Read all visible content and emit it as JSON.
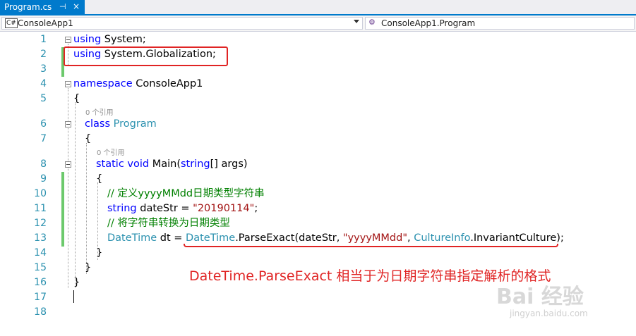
{
  "tab": {
    "title": "Program.cs",
    "pin": "⊣",
    "close": "×"
  },
  "navbar": {
    "project": {
      "icon": "C#",
      "label": "ConsoleApp1"
    },
    "member": {
      "icon": "⚙",
      "label": "ConsoleApp1.Program"
    }
  },
  "line_numbers": [
    "1",
    "2",
    "3",
    "4",
    "5",
    "6",
    "7",
    "8",
    "9",
    "10",
    "11",
    "12",
    "13",
    "14",
    "15",
    "16",
    "17",
    "18"
  ],
  "code": {
    "l1_kw": "using",
    "l1_rest": " System;",
    "l2_kw": "using",
    "l2_rest": " System.Globalization;",
    "l4_kw": "namespace",
    "l4_rest": " ConsoleApp1",
    "l5": "{",
    "ref_class": "0 个引用",
    "l6_kw": "class",
    "l6_type": "Program",
    "l7": "{",
    "ref_main": "0 个引用",
    "l8_kw1": "static",
    "l8_kw2": "void",
    "l8_name": " Main(",
    "l8_kw3": "string",
    "l8_rest": "[] args)",
    "l9": "{",
    "l10_comment": "// 定义yyyyMMdd日期类型字符串",
    "l11_kw": "string",
    "l11_mid": " dateStr = ",
    "l11_str": "\"20190114\"",
    "l11_end": ";",
    "l12_comment": "// 将字符串转换为日期类型",
    "l13_type1": "DateTime",
    "l13_mid1": " dt = ",
    "l13_type2": "DateTime",
    "l13_mid2": ".ParseExact(dateStr, ",
    "l13_str": "\"yyyyMMdd\"",
    "l13_comma": ", ",
    "l13_type3": "CultureInfo",
    "l13_end": ".InvariantCulture);",
    "l14": "}",
    "l15": "}",
    "l16": "}"
  },
  "annotation": "DateTime.ParseExact 相当于为日期字符串指定解析的格式",
  "watermark": {
    "logo": "Bai 经验",
    "url": "jingyan.baidu.com"
  },
  "colors": {
    "keyword": "#0000ff",
    "type": "#2b91af",
    "string": "#a31515",
    "comment": "#008000",
    "annotation": "#e02424",
    "accent": "#007acc"
  }
}
